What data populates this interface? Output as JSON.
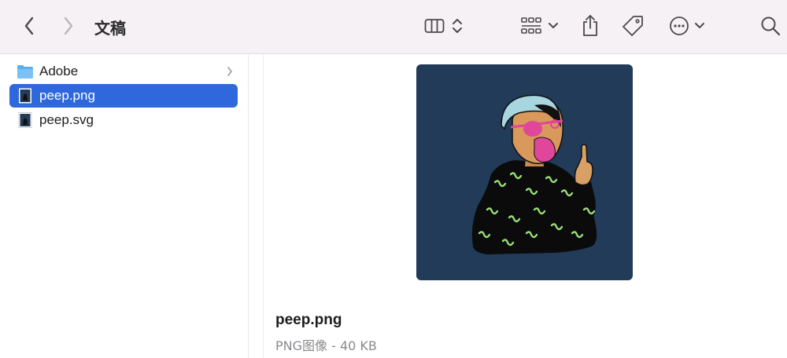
{
  "toolbar": {
    "title": "文稿",
    "icons": [
      "chevron-left-icon",
      "chevron-right-icon",
      "column-view-icon",
      "updown-chevron-icon",
      "grid-group-icon",
      "chevron-down-icon",
      "share-icon",
      "tag-icon",
      "more-icon",
      "search-icon"
    ]
  },
  "sidebar": {
    "items": [
      {
        "label": "Adobe",
        "type": "folder",
        "has_children": true,
        "selected": false
      },
      {
        "label": "peep.png",
        "type": "image",
        "selected": true
      },
      {
        "label": "peep.svg",
        "type": "image",
        "selected": false
      }
    ]
  },
  "preview": {
    "file_name": "peep.png",
    "file_meta": "PNG图像 - 40 KB"
  },
  "colors": {
    "selection": "#2f68dc",
    "folder": "#5aaef0",
    "preview_bg": "#213b58",
    "toolbar_bg": "#f6f1f5"
  }
}
